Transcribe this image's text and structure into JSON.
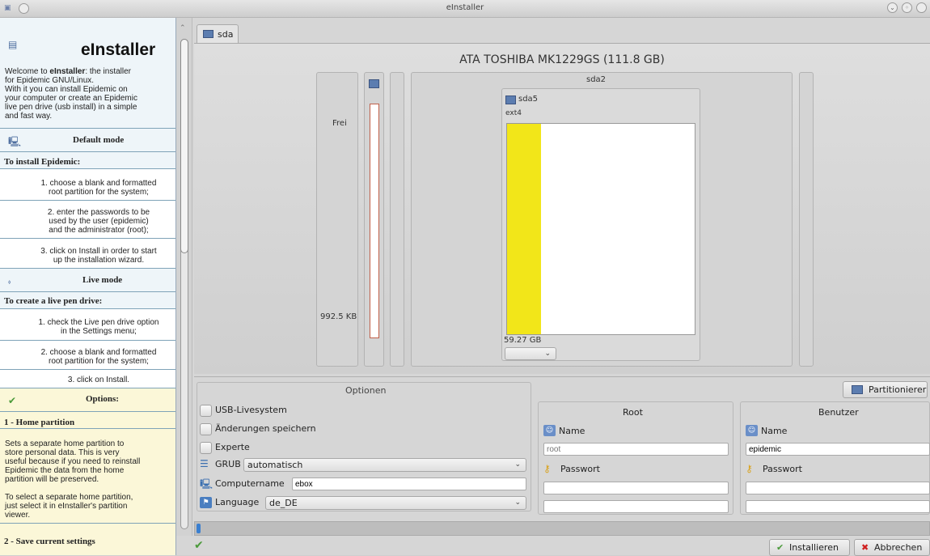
{
  "window": {
    "title": "eInstaller"
  },
  "help": {
    "title": "eInstaller",
    "intro": [
      "Welcome to ",
      "eInstaller",
      ": the installer",
      "for Epidemic GNU/Linux.",
      "With it you can install Epidemic on",
      "your computer or create an Epidemic",
      "live pen drive (usb install) in a simple",
      "and fast way."
    ],
    "default_mode": "Default mode",
    "to_install": "To install Epidemic:",
    "install_steps": [
      [
        "1. choose a blank and formatted",
        "root partition for the system;"
      ],
      [
        "2. enter the passwords to be",
        "used by the user (epidemic)",
        "and the administrator (root);"
      ],
      [
        "3. click on Install in order to start",
        "up the installation wizard."
      ]
    ],
    "live_mode": "Live mode",
    "to_create": "To create a live pen drive:",
    "live_steps": [
      [
        "1. check the Live pen drive option",
        "in the Settings menu;"
      ],
      [
        "2. choose a blank and formatted",
        "root partition for the system;"
      ],
      [
        "3. click on Install."
      ]
    ],
    "options": "Options:",
    "home_heading": "1 - Home partition",
    "home_text": [
      "Sets a separate home partition to",
      "store personal data. This is very",
      "useful because if you need to reinstall",
      "Epidemic the data from the home",
      "partition will be preserved."
    ],
    "home_text2": [
      "To select a separate home partition,",
      "just select it in eInstaller's partition",
      "viewer."
    ],
    "save_heading": "2 - Save current settings"
  },
  "tab": {
    "label": "sda"
  },
  "disk": {
    "title": "ATA TOSHIBA MK1229GS (111.8 GB)",
    "free_label": "Frei",
    "free_size": "992.5 KB",
    "extended_label": "sda2",
    "partition_name": "sda5",
    "partition_fs": "ext4",
    "partition_size": "59.27 GB",
    "partition_used_fraction": 0.18,
    "used_color": "#f2e619"
  },
  "options": {
    "title": "Optionen",
    "usb_live": "USB-Livesystem",
    "save_changes": "Änderungen speichern",
    "expert": "Experte",
    "grub_label": "GRUB",
    "grub_value": "automatisch",
    "computer_label": "Computername",
    "computer_value": "ebox",
    "language_label": "Language",
    "language_value": "de_DE"
  },
  "partition_button": "Partitionierer",
  "root": {
    "title": "Root",
    "name_label": "Name",
    "name_placeholder": "root",
    "password_label": "Passwort"
  },
  "user": {
    "title": "Benutzer",
    "name_label": "Name",
    "name_value": "epidemic",
    "password_label": "Passwort"
  },
  "buttons": {
    "install": "Installieren",
    "cancel": "Abbrechen"
  }
}
